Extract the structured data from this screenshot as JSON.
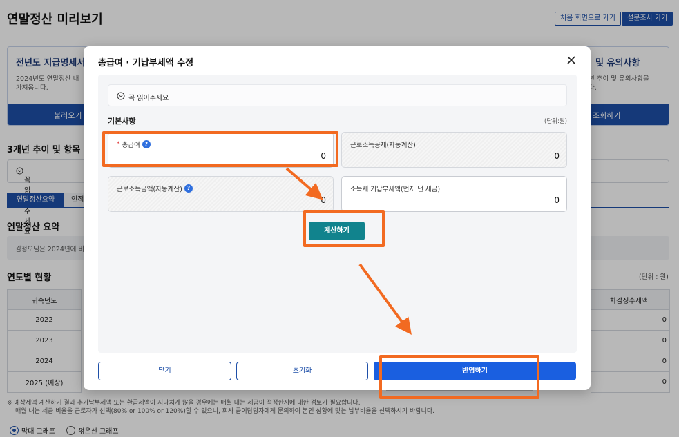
{
  "page": {
    "title": "연말정산 미리보기",
    "first_button": "처음 화면으로 가기",
    "survey_button": "설문조사 가기"
  },
  "card_left": {
    "title": "전년도 지급명세서",
    "desc_line1": "2024년도 연말정산 내",
    "desc_line2": "가져옵니다.",
    "button": "불러오기"
  },
  "card_right": {
    "title": "및 유의사항",
    "desc_line1": "년 추이 및 유의사항을",
    "desc_line2": "다.",
    "button": "조회하기"
  },
  "trend_section": {
    "title": "3개년 추이 및 항목",
    "readme": "꼭 읽어주세요"
  },
  "tabs": {
    "active": "연말정산요약",
    "other": "인적"
  },
  "summary": {
    "title": "연말정산 요약",
    "text": "김정오님은 2024년에 비"
  },
  "yearly": {
    "title": "연도별 현황",
    "unit": "(단위 : 원)",
    "col_year": "귀속년도",
    "col_last": "차감징수세액",
    "rows": [
      {
        "year": "2022",
        "value": "0"
      },
      {
        "year": "2023",
        "value": "0"
      },
      {
        "year": "2024",
        "value": "0"
      },
      {
        "year": "2025 (예상)",
        "value": "0"
      }
    ]
  },
  "notes": {
    "line1": "※ 예상세액 계산하기 결과 추가납부세액 또는 환급세액이 지나치게 많을 경우에는 매월 내는 세금이 적정한지에 대한 검토가 필요합니다.",
    "line2": "매월 내는 세금 비율을 근로자가 선택(80% or 100% or 120%)할 수 있으니, 회사 급여담당자에게 문의하여 본인 상황에 맞는 납부비율을 선택하시기 바랍니다."
  },
  "graph_options": {
    "bar": "막대 그래프",
    "line": "꺾은선 그래프"
  },
  "modal": {
    "title": "총급여 · 기납부세액 수정",
    "readme": "꼭 읽어주세요",
    "section_label": "기본사항",
    "unit": "(단위:원)",
    "fields": {
      "total_salary": {
        "label": "총급여",
        "required_mark": "*",
        "value": "0"
      },
      "earned_income_deduction": {
        "label": "근로소득공제(자동계산)",
        "value": "0"
      },
      "earned_income_amount": {
        "label": "근로소득금액(자동계산)",
        "value": "0"
      },
      "prepaid_tax": {
        "label": "소득세 기납부세액(먼저 낸 세금)",
        "value": "0"
      }
    },
    "help_icon_text": "?",
    "calc_button": "계산하기",
    "close_button": "닫기",
    "reset_button": "초기화",
    "apply_button": "반영하기"
  },
  "colors": {
    "brand_blue": "#1e4fa8",
    "apply_blue": "#1a5fe0",
    "calc_teal": "#11838d",
    "annotation_orange": "#f26a21"
  }
}
